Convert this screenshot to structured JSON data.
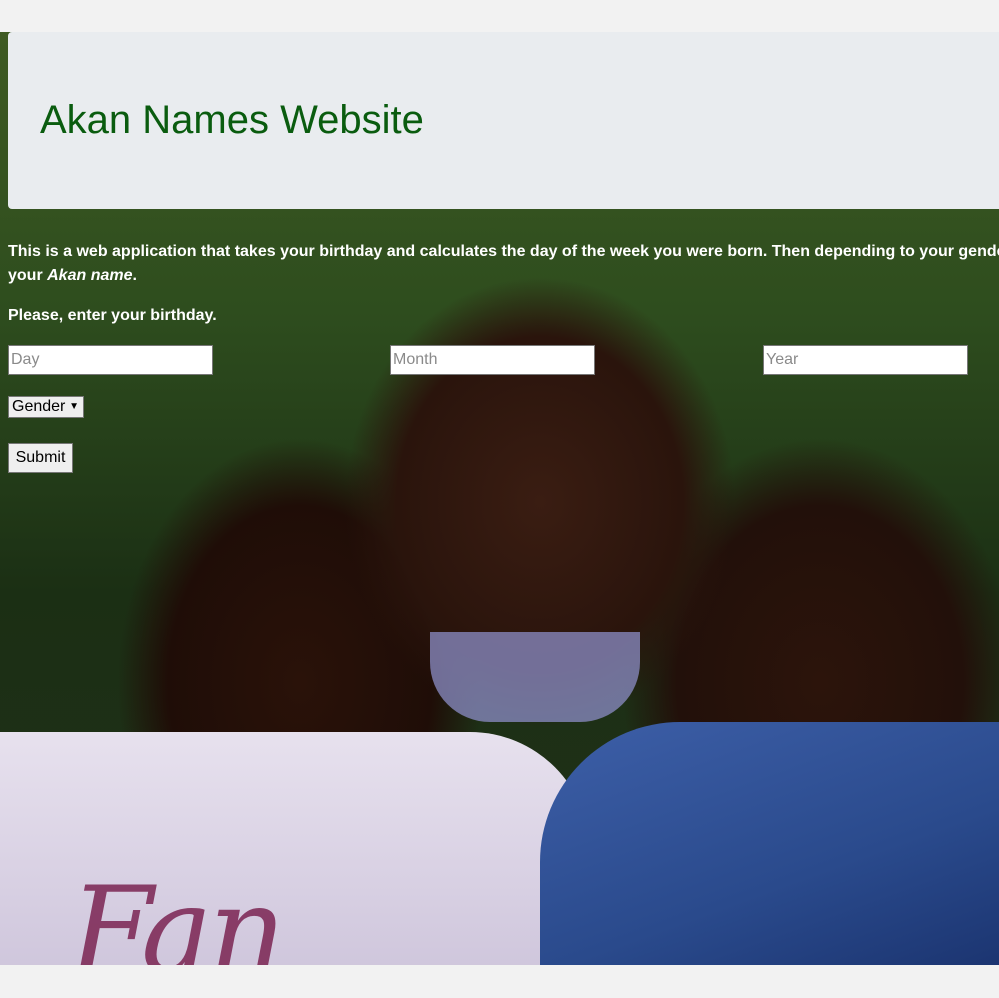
{
  "header": {
    "title": "Akan Names Website"
  },
  "intro": {
    "text_line1": "This is a web application that takes your birthday and calculates the day of the week you were born. Then depending to your gende",
    "text_line2_prefix": "your ",
    "text_line2_emphasis": "Akan name",
    "text_line2_suffix": "."
  },
  "form": {
    "prompt": "Please, enter your birthday.",
    "day_placeholder": "Day",
    "month_placeholder": "Month",
    "year_placeholder": "Year",
    "gender_selected": "Gender",
    "submit_label": "Submit"
  },
  "hero_image": {
    "shirt_text": "Fan"
  },
  "colors": {
    "title": "#0a5c0f",
    "header_bg": "#e9ecef",
    "page_bg": "#f2f2f2"
  }
}
